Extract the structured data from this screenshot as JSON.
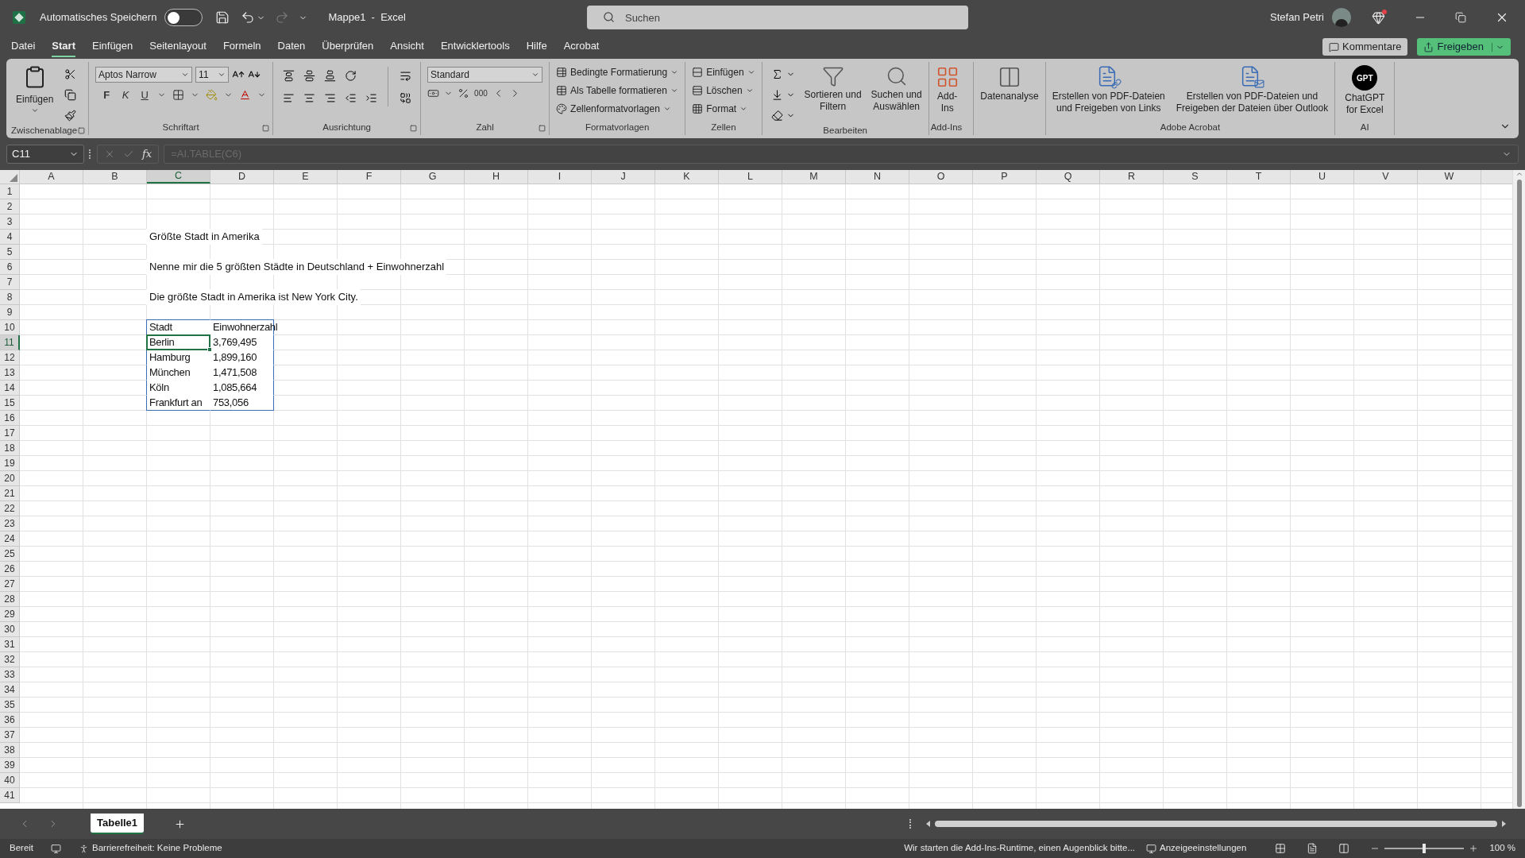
{
  "title_bar": {
    "autosave_label": "Automatisches Speichern",
    "autosave_on": false,
    "document_title": "Mappe1  -  Excel",
    "search_placeholder": "Suchen",
    "user_name": "Stefan Petri"
  },
  "menu_tabs": [
    {
      "label": "Datei",
      "selected": false
    },
    {
      "label": "Start",
      "selected": true
    },
    {
      "label": "Einfügen",
      "selected": false
    },
    {
      "label": "Seitenlayout",
      "selected": false
    },
    {
      "label": "Formeln",
      "selected": false
    },
    {
      "label": "Daten",
      "selected": false
    },
    {
      "label": "Überprüfen",
      "selected": false
    },
    {
      "label": "Ansicht",
      "selected": false
    },
    {
      "label": "Entwicklertools",
      "selected": false
    },
    {
      "label": "Hilfe",
      "selected": false
    },
    {
      "label": "Acrobat",
      "selected": false
    }
  ],
  "header_buttons": {
    "comments": "Kommentare",
    "share": "Freigeben"
  },
  "ribbon": {
    "groups": [
      {
        "kind": "clipboard",
        "name": "Zwischenablage",
        "paste_label": "Einfügen"
      },
      {
        "kind": "font",
        "name": "Schriftart",
        "font": "Aptos Narrow",
        "size": "11",
        "bold": "F",
        "italic": "K",
        "underline": "U"
      },
      {
        "kind": "alignment",
        "name": "Ausrichtung"
      },
      {
        "kind": "number",
        "name": "Zahl",
        "format": "Standard",
        "thousands": "000"
      },
      {
        "kind": "styles",
        "name": "Formatvorlagen",
        "items": [
          "Bedingte Formatierung",
          "Als Tabelle formatieren",
          "Zellenformatvorlagen"
        ]
      },
      {
        "kind": "cells",
        "name": "Zellen",
        "items": [
          "Einfügen",
          "Löschen",
          "Format"
        ]
      },
      {
        "kind": "editing",
        "name": "Bearbeiten",
        "items": [
          {
            "lines": [
              "Sortieren und",
              "Filtern"
            ]
          },
          {
            "lines": [
              "Suchen und",
              "Auswählen"
            ]
          }
        ]
      },
      {
        "kind": "addins",
        "name": "Add-Ins",
        "lines": [
          "Add-",
          "Ins"
        ]
      },
      {
        "kind": "analysis",
        "lines": [
          "Datenanalyse"
        ]
      },
      {
        "kind": "acrobat",
        "name": "Adobe Acrobat",
        "items": [
          {
            "lines": [
              "Erstellen von PDF-Dateien",
              "und Freigeben von Links"
            ]
          },
          {
            "lines": [
              "Erstellen von PDF-Dateien und",
              "Freigeben der Dateien über Outlook"
            ]
          }
        ]
      },
      {
        "kind": "ai",
        "name": "AI",
        "logo": "GPT",
        "lines": [
          "ChatGPT",
          "for Excel"
        ]
      }
    ]
  },
  "formula_bar": {
    "name_box": "C11",
    "function_label": "fx",
    "formula": "=AI.TABLE(C6)"
  },
  "sheet": {
    "columns": [
      {
        "label": "A",
        "selected": false
      },
      {
        "label": "B",
        "selected": false
      },
      {
        "label": "C",
        "selected": true
      },
      {
        "label": "D",
        "selected": false
      },
      {
        "label": "E",
        "selected": false
      },
      {
        "label": "F",
        "selected": false
      },
      {
        "label": "G",
        "selected": false
      },
      {
        "label": "H",
        "selected": false
      },
      {
        "label": "I",
        "selected": false
      },
      {
        "label": "J",
        "selected": false
      },
      {
        "label": "K",
        "selected": false
      },
      {
        "label": "L",
        "selected": false
      },
      {
        "label": "M",
        "selected": false
      },
      {
        "label": "N",
        "selected": false
      },
      {
        "label": "O",
        "selected": false
      },
      {
        "label": "P",
        "selected": false
      },
      {
        "label": "Q",
        "selected": false
      },
      {
        "label": "R",
        "selected": false
      },
      {
        "label": "S",
        "selected": false
      },
      {
        "label": "T",
        "selected": false
      },
      {
        "label": "U",
        "selected": false
      },
      {
        "label": "V",
        "selected": false
      },
      {
        "label": "W",
        "selected": false
      }
    ],
    "rows": [
      {
        "number": "1",
        "selected": false
      },
      {
        "number": "2",
        "selected": false
      },
      {
        "number": "3",
        "selected": false
      },
      {
        "number": "4",
        "selected": false,
        "cells": [
          null,
          null,
          {
            "text": "Größte Stadt in Amerika",
            "in_table": false,
            "selected": false
          }
        ]
      },
      {
        "number": "5",
        "selected": false
      },
      {
        "number": "6",
        "selected": false,
        "cells": [
          null,
          null,
          {
            "text": "Nenne mir die 5 größten Städte in Deutschland + Einwohnerzahl",
            "in_table": false,
            "selected": false
          }
        ]
      },
      {
        "number": "7",
        "selected": false
      },
      {
        "number": "8",
        "selected": false,
        "cells": [
          null,
          null,
          {
            "text": "Die größte Stadt in Amerika ist New York City.",
            "in_table": false,
            "selected": false
          }
        ]
      },
      {
        "number": "9",
        "selected": false
      },
      {
        "number": "10",
        "selected": false,
        "cells": [
          null,
          null,
          {
            "text": "Stadt",
            "in_table": true,
            "selected": false
          },
          {
            "text": "Einwohnerzahl",
            "in_table": true,
            "selected": false
          }
        ]
      },
      {
        "number": "11",
        "selected": true,
        "cells": [
          null,
          null,
          {
            "text": "Berlin",
            "in_table": true,
            "selected": true
          },
          {
            "text": "3,769,495",
            "in_table": true,
            "selected": false
          }
        ]
      },
      {
        "number": "12",
        "selected": false,
        "cells": [
          null,
          null,
          {
            "text": "Hamburg",
            "in_table": true,
            "selected": false
          },
          {
            "text": "1,899,160",
            "in_table": true,
            "selected": false
          }
        ]
      },
      {
        "number": "13",
        "selected": false,
        "cells": [
          null,
          null,
          {
            "text": "München",
            "in_table": true,
            "selected": false
          },
          {
            "text": "1,471,508",
            "in_table": true,
            "selected": false
          }
        ]
      },
      {
        "number": "14",
        "selected": false,
        "cells": [
          null,
          null,
          {
            "text": "Köln",
            "in_table": true,
            "selected": false
          },
          {
            "text": "1,085,664",
            "in_table": true,
            "selected": false
          }
        ]
      },
      {
        "number": "15",
        "selected": false,
        "cells": [
          null,
          null,
          {
            "text": "Frankfurt an",
            "in_table": true,
            "selected": false
          },
          {
            "text": "753,056",
            "in_table": true,
            "selected": false
          }
        ]
      },
      {
        "number": "16",
        "selected": false
      },
      {
        "number": "17",
        "selected": false
      },
      {
        "number": "18",
        "selected": false
      },
      {
        "number": "19",
        "selected": false
      },
      {
        "number": "20",
        "selected": false
      },
      {
        "number": "21",
        "selected": false
      },
      {
        "number": "22",
        "selected": false
      },
      {
        "number": "23",
        "selected": false
      },
      {
        "number": "24",
        "selected": false
      },
      {
        "number": "25",
        "selected": false
      },
      {
        "number": "26",
        "selected": false
      },
      {
        "number": "27",
        "selected": false
      },
      {
        "number": "28",
        "selected": false
      },
      {
        "number": "29",
        "selected": false
      },
      {
        "number": "30",
        "selected": false
      },
      {
        "number": "31",
        "selected": false
      },
      {
        "number": "32",
        "selected": false
      },
      {
        "number": "33",
        "selected": false
      },
      {
        "number": "34",
        "selected": false
      },
      {
        "number": "35",
        "selected": false
      },
      {
        "number": "36",
        "selected": false
      },
      {
        "number": "37",
        "selected": false
      },
      {
        "number": "38",
        "selected": false
      },
      {
        "number": "39",
        "selected": false
      },
      {
        "number": "40",
        "selected": false
      },
      {
        "number": "41",
        "selected": false
      }
    ]
  },
  "sheet_tabs": [
    {
      "label": "Tabelle1",
      "selected": true
    }
  ],
  "status_bar": {
    "ready": "Bereit",
    "accessibility": "Barrierefreiheit: Keine Probleme",
    "message": "Wir starten die Add-Ins-Runtime, einen Augenblick bitte...",
    "display_settings": "Anzeigeeinstellungen",
    "zoom": "100 %",
    "zoom_level": {
      "level": 0.5
    }
  }
}
